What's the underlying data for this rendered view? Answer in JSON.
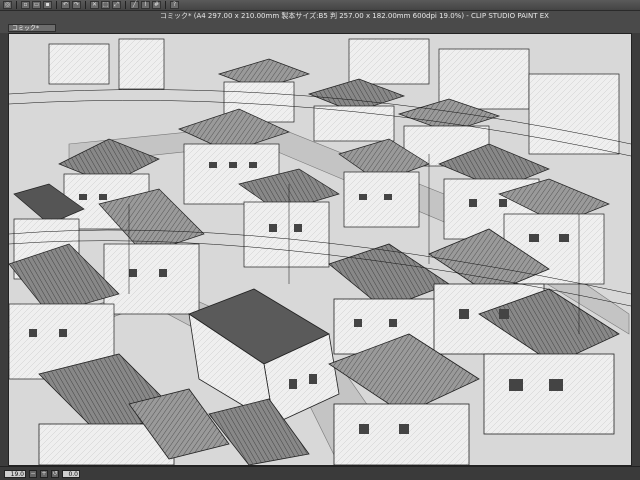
{
  "window": {
    "title": "コミック* (A4 297.00 x 210.00mm 製本サイズ:B5 判 257.00 x 182.00mm 600dpi 19.0%) - CLIP STUDIO PAINT EX"
  },
  "toolbar": {
    "buttons": [
      {
        "icon": "clip-studio-logo-icon"
      },
      {
        "icon": "new-document-icon"
      },
      {
        "icon": "open-icon"
      },
      {
        "icon": "save-icon"
      },
      {
        "icon": "undo-icon"
      },
      {
        "icon": "redo-icon"
      },
      {
        "icon": "erase-icon"
      },
      {
        "icon": "deselect-icon"
      },
      {
        "icon": "transform-icon"
      },
      {
        "icon": "snap-ruler-icon"
      },
      {
        "icon": "snap-special-ruler-icon"
      },
      {
        "icon": "snap-grid-icon"
      },
      {
        "icon": "help-icon"
      }
    ]
  },
  "tabs": [
    {
      "label": "コミック*"
    }
  ],
  "canvas": {
    "description_icon": "artwork-icon"
  },
  "statusbar": {
    "zoom": "19.0",
    "angle": "0.0"
  }
}
